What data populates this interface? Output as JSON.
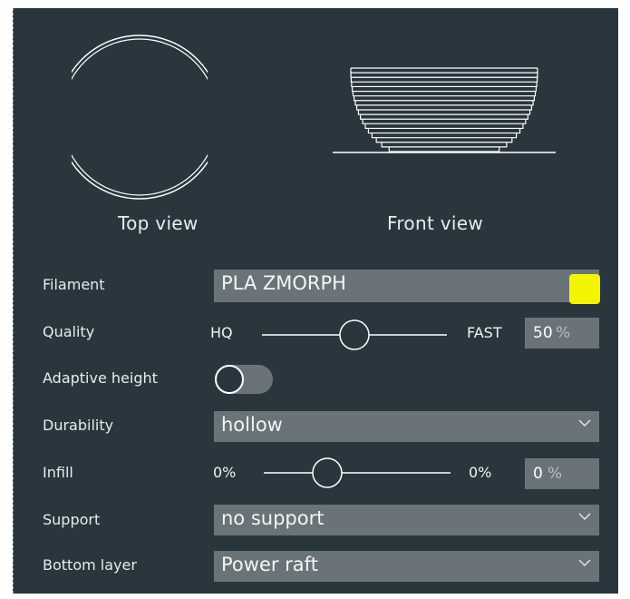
{
  "views": {
    "top_label": "Top view",
    "front_label": "Front view"
  },
  "filament": {
    "label": "Filament",
    "value": "PLA ZMORPH",
    "color": "#f3f500"
  },
  "quality": {
    "label": "Quality",
    "min_label": "HQ",
    "max_label": "FAST",
    "value": "50",
    "unit": "%",
    "slider_level": 0.5
  },
  "adaptive_height": {
    "label": "Adaptive height",
    "enabled": false
  },
  "durability": {
    "label": "Durability",
    "value": "hollow"
  },
  "infill": {
    "label": "Infill",
    "min_label": "0%",
    "max_label": "0%",
    "value": "0",
    "unit": "%",
    "slider_level": 0.35
  },
  "support": {
    "label": "Support",
    "value": "no support"
  },
  "bottom_layer": {
    "label": "Bottom layer",
    "value": "Power raft"
  },
  "icons": [
    "chevron-down-icon",
    "toggle-knob",
    "slider-handle"
  ]
}
